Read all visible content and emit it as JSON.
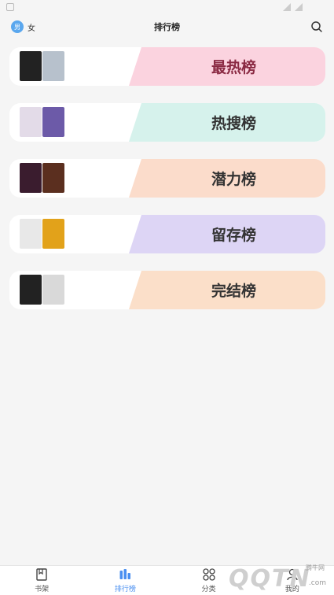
{
  "header": {
    "title": "排行榜",
    "gender_male": "男",
    "gender_female": "女"
  },
  "colors": {
    "accent": "#4a8ff0",
    "male_badge": "#5aa7ee"
  },
  "rankings": [
    {
      "label": "最热榜",
      "bg": "#fbd3df",
      "text_color": "#8a2a43",
      "covers": [
        "#222222",
        "#b7c1cc"
      ]
    },
    {
      "label": "热搜榜",
      "bg": "#d6f2ec",
      "text_color": "#333333",
      "covers": [
        "#e3dbe8",
        "#6c5aa8"
      ]
    },
    {
      "label": "潜力榜",
      "bg": "#fbdccb",
      "text_color": "#333333",
      "covers": [
        "#3a1c2e",
        "#5b2f1f"
      ]
    },
    {
      "label": "留存榜",
      "bg": "#ddd5f5",
      "text_color": "#333333",
      "covers": [
        "#e8e8e8",
        "#e2a21a"
      ]
    },
    {
      "label": "完结榜",
      "bg": "#fbdfc9",
      "text_color": "#333333",
      "covers": [
        "#222222",
        "#d9d9d9"
      ]
    }
  ],
  "tabbar": [
    {
      "label": "书架",
      "icon": "bookshelf-icon",
      "active": false
    },
    {
      "label": "排行榜",
      "icon": "chart-bars-icon",
      "active": true
    },
    {
      "label": "分类",
      "icon": "category-icon",
      "active": false
    },
    {
      "label": "我的",
      "icon": "user-icon",
      "active": false
    }
  ],
  "watermark": {
    "text": "QQTN",
    "site": "腾牛网",
    "domain": ".com"
  }
}
